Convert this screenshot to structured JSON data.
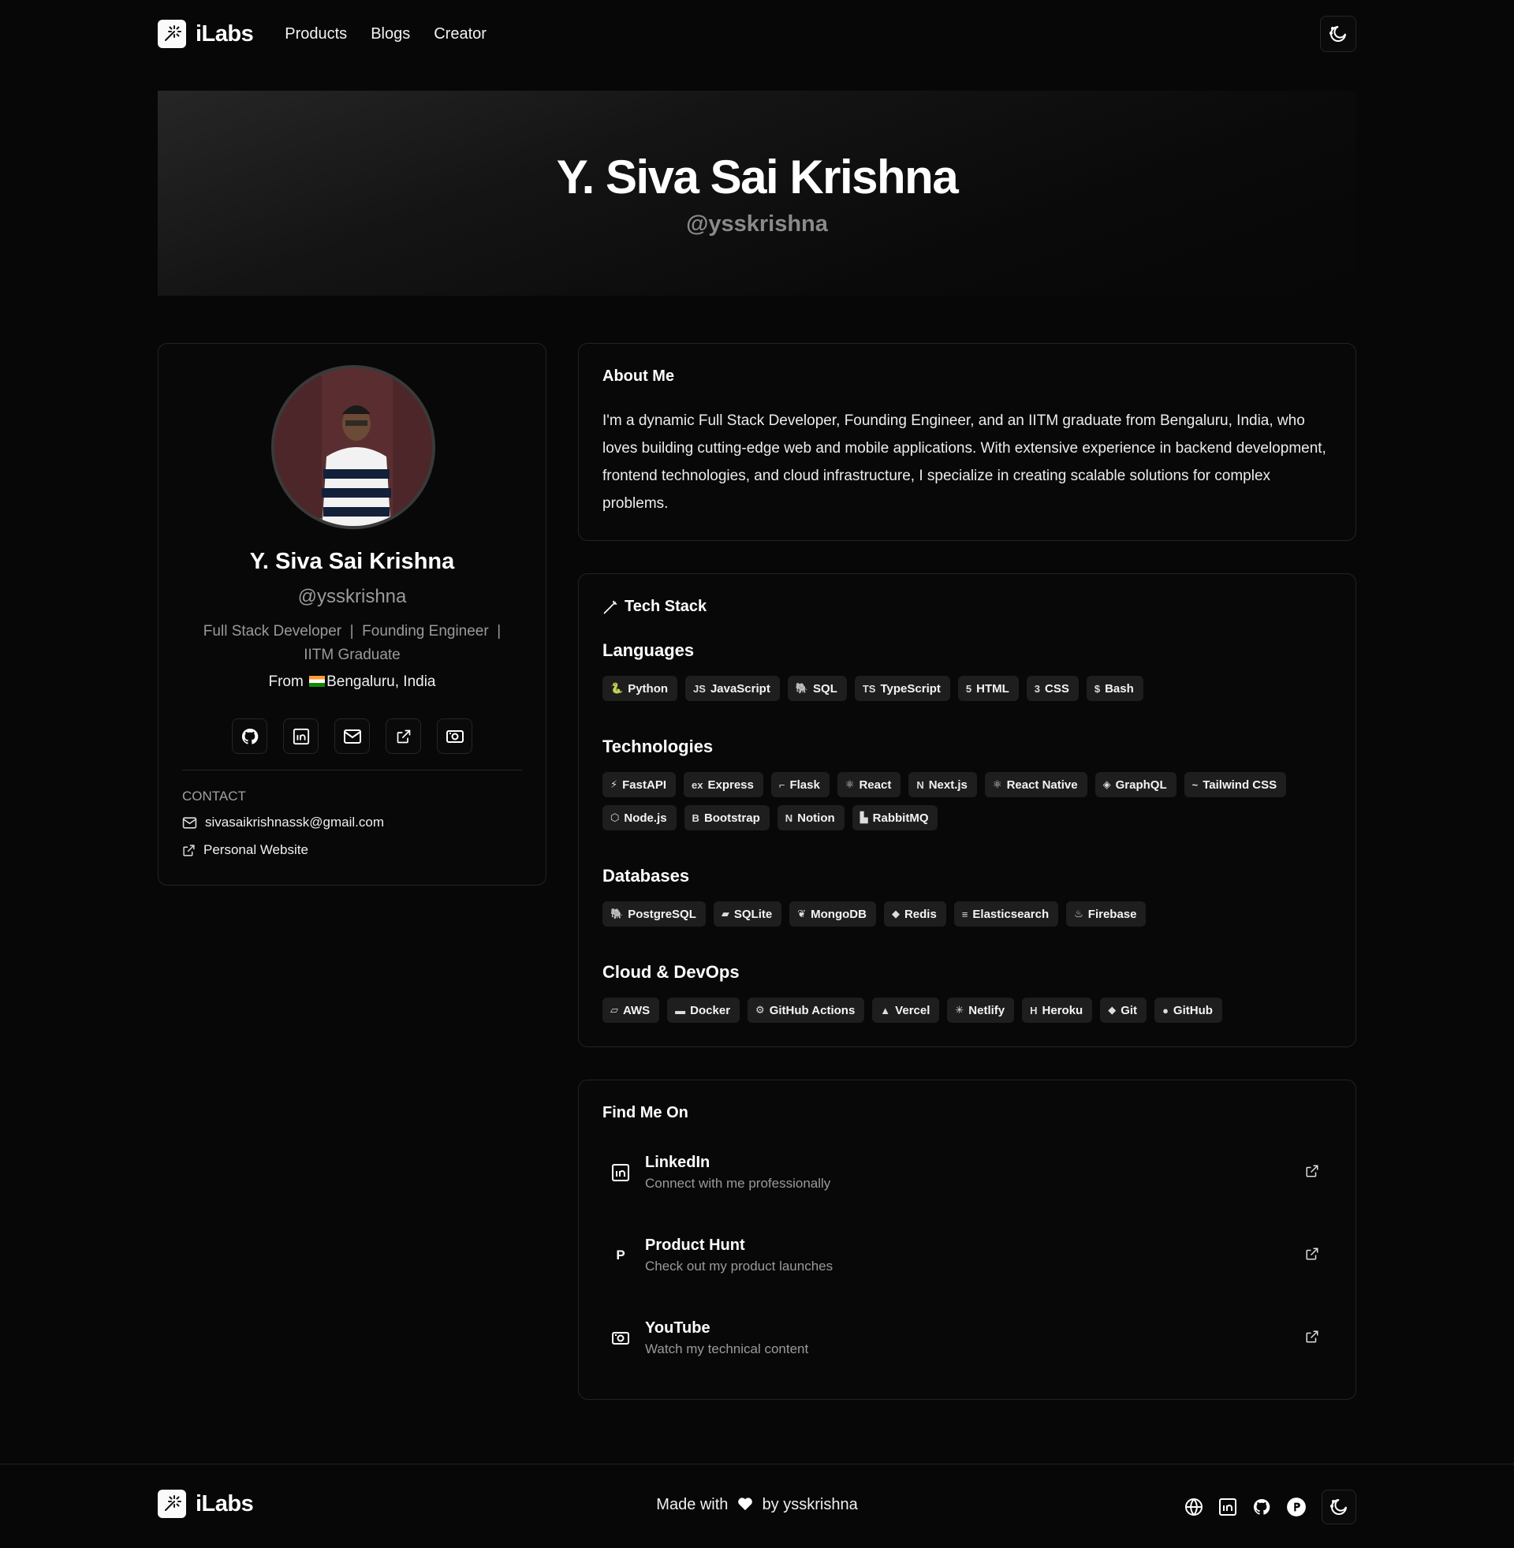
{
  "nav": {
    "brand": "iLabs",
    "links": [
      "Products",
      "Blogs",
      "Creator"
    ]
  },
  "hero": {
    "name": "Y. Siva Sai Krishna",
    "handle": "@ysskrishna"
  },
  "profile": {
    "name": "Y. Siva Sai Krishna",
    "handle": "@ysskrishna",
    "roles_line1": "Full Stack Developer  |  Founding Engineer  |",
    "roles_line2": "IITM Graduate",
    "from_label": "From",
    "location": "Bengaluru, India",
    "contact_heading": "CONTACT",
    "email": "sivasaikrishnassk@gmail.com",
    "website_label": "Personal Website"
  },
  "about": {
    "title": "About Me",
    "text": "I'm a dynamic Full Stack Developer, Founding Engineer, and an IITM graduate from Bengaluru, India, who loves building cutting-edge web and mobile applications. With extensive experience in backend development, frontend technologies, and cloud infrastructure, I specialize in creating scalable solutions for complex problems."
  },
  "tech": {
    "title": "Tech Stack",
    "sections": [
      {
        "heading": "Languages",
        "items": [
          "Python",
          "JavaScript",
          "SQL",
          "TypeScript",
          "HTML",
          "CSS",
          "Bash"
        ]
      },
      {
        "heading": "Technologies",
        "items": [
          "FastAPI",
          "Express",
          "Flask",
          "React",
          "Next.js",
          "React Native",
          "GraphQL",
          "Tailwind CSS",
          "Node.js",
          "Bootstrap",
          "Notion",
          "RabbitMQ"
        ]
      },
      {
        "heading": "Databases",
        "items": [
          "PostgreSQL",
          "SQLite",
          "MongoDB",
          "Redis",
          "Elasticsearch",
          "Firebase"
        ]
      },
      {
        "heading": "Cloud & DevOps",
        "items": [
          "AWS",
          "Docker",
          "GitHub Actions",
          "Vercel",
          "Netlify",
          "Heroku",
          "Git",
          "GitHub"
        ]
      }
    ]
  },
  "findme": {
    "title": "Find Me On",
    "items": [
      {
        "title": "LinkedIn",
        "sub": "Connect with me professionally",
        "icon": "linkedin-icon"
      },
      {
        "title": "Product Hunt",
        "sub": "Check out my product launches",
        "icon": "producthunt-icon"
      },
      {
        "title": "YouTube",
        "sub": "Watch my technical content",
        "icon": "youtube-icon"
      }
    ]
  },
  "footer": {
    "brand": "iLabs",
    "made_with": "Made with",
    "by": "by ysskrishna"
  },
  "badge_icons": {
    "Python": "🐍",
    "JavaScript": "JS",
    "SQL": "🐘",
    "TypeScript": "TS",
    "HTML": "5",
    "CSS": "3",
    "Bash": "$",
    "FastAPI": "⚡",
    "Express": "ex",
    "Flask": "⌐",
    "React": "⚛",
    "Next.js": "N",
    "React Native": "⚛",
    "GraphQL": "◈",
    "Tailwind CSS": "~",
    "Node.js": "⬡",
    "Bootstrap": "B",
    "Notion": "N",
    "RabbitMQ": "▙",
    "PostgreSQL": "🐘",
    "SQLite": "▰",
    "MongoDB": "❦",
    "Redis": "◆",
    "Elasticsearch": "≡",
    "Firebase": "♨",
    "AWS": "▱",
    "Docker": "▬",
    "GitHub Actions": "⚙",
    "Vercel": "▲",
    "Netlify": "✳",
    "Heroku": "H",
    "Git": "◆",
    "GitHub": "●"
  }
}
